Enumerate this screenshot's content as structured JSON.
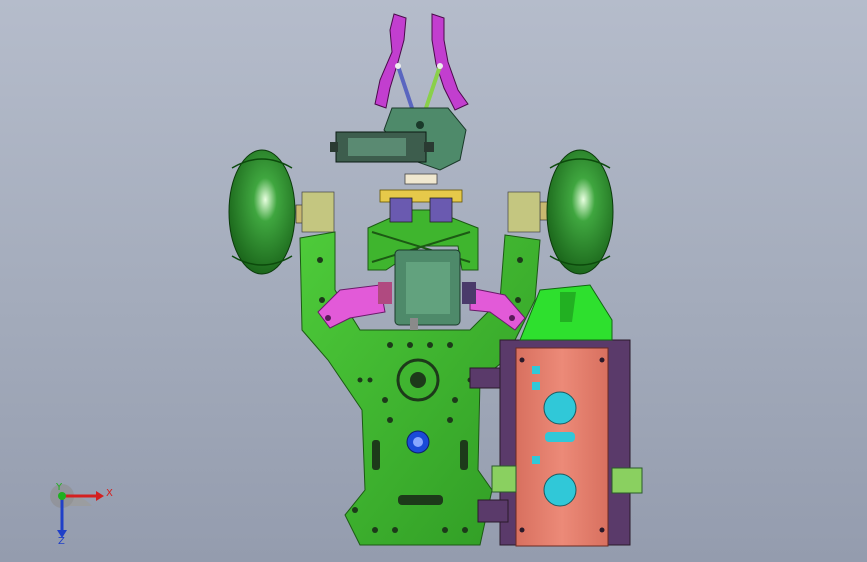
{
  "viewport": {
    "background_top": "#b5bccb",
    "background_bottom": "#949cae"
  },
  "model": {
    "parts": [
      "robot-chassis",
      "gripper-claw",
      "servo-motor",
      "left-wheel",
      "right-wheel",
      "battery-box",
      "front-bracket"
    ],
    "colors": {
      "chassis": "#3fb52e",
      "wheel": "#1e7a1e",
      "claw": "#c23ecf",
      "servo": "#4e8a6a",
      "battery_box": "#e07a6a",
      "battery_cap": "#2ee02e",
      "frame": "#5a3a6a",
      "bracket": "#e6c94a"
    }
  },
  "triad": {
    "x_label": "X",
    "y_label": "Y",
    "z_label": "Z",
    "x_color": "#d42020",
    "y_color": "#20b020",
    "z_color": "#2040c8"
  }
}
